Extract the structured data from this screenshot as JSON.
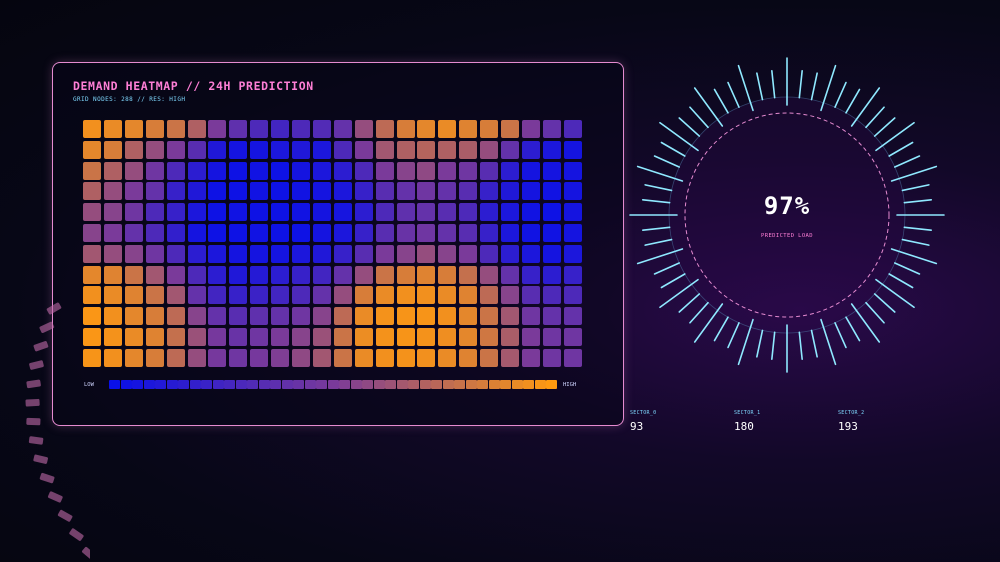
{
  "panel": {
    "title": "DEMAND HEATMAP // 24H PREDICTION",
    "subtitle": "GRID NODES: 288 // RES: HIGH"
  },
  "heatmap": {
    "rows": 12,
    "cols": 24,
    "values": [
      [
        0.95,
        0.92,
        0.9,
        0.85,
        0.8,
        0.7,
        0.5,
        0.38,
        0.3,
        0.25,
        0.3,
        0.32,
        0.4,
        0.6,
        0.75,
        0.85,
        0.9,
        0.92,
        0.88,
        0.85,
        0.8,
        0.5,
        0.4,
        0.3
      ],
      [
        0.9,
        0.85,
        0.7,
        0.6,
        0.5,
        0.35,
        0.1,
        0.05,
        0.05,
        0.08,
        0.1,
        0.08,
        0.3,
        0.5,
        0.65,
        0.7,
        0.72,
        0.7,
        0.68,
        0.6,
        0.4,
        0.15,
        0.08,
        0.05
      ],
      [
        0.8,
        0.7,
        0.6,
        0.45,
        0.3,
        0.15,
        0.05,
        0.02,
        0.03,
        0.02,
        0.05,
        0.08,
        0.15,
        0.3,
        0.5,
        0.55,
        0.58,
        0.5,
        0.45,
        0.35,
        0.15,
        0.05,
        0.05,
        0.05
      ],
      [
        0.7,
        0.6,
        0.5,
        0.4,
        0.2,
        0.1,
        0.02,
        0.02,
        0.03,
        0.02,
        0.03,
        0.05,
        0.08,
        0.2,
        0.35,
        0.4,
        0.45,
        0.4,
        0.35,
        0.2,
        0.1,
        0.05,
        0.03,
        0.05
      ],
      [
        0.6,
        0.55,
        0.45,
        0.3,
        0.2,
        0.08,
        0.02,
        0.03,
        0.02,
        0.02,
        0.03,
        0.05,
        0.06,
        0.15,
        0.3,
        0.38,
        0.4,
        0.35,
        0.3,
        0.15,
        0.08,
        0.03,
        0.02,
        0.05
      ],
      [
        0.55,
        0.5,
        0.4,
        0.3,
        0.18,
        0.05,
        0.02,
        0.02,
        0.03,
        0.02,
        0.02,
        0.05,
        0.08,
        0.2,
        0.35,
        0.42,
        0.45,
        0.4,
        0.35,
        0.2,
        0.08,
        0.03,
        0.03,
        0.05
      ],
      [
        0.65,
        0.6,
        0.55,
        0.45,
        0.3,
        0.15,
        0.08,
        0.05,
        0.05,
        0.05,
        0.08,
        0.1,
        0.2,
        0.35,
        0.5,
        0.55,
        0.6,
        0.55,
        0.5,
        0.3,
        0.15,
        0.08,
        0.05,
        0.08
      ],
      [
        0.9,
        0.88,
        0.8,
        0.65,
        0.5,
        0.3,
        0.15,
        0.1,
        0.12,
        0.15,
        0.2,
        0.25,
        0.4,
        0.6,
        0.8,
        0.85,
        0.88,
        0.85,
        0.78,
        0.6,
        0.4,
        0.2,
        0.15,
        0.2
      ],
      [
        0.95,
        0.92,
        0.88,
        0.8,
        0.65,
        0.4,
        0.25,
        0.2,
        0.22,
        0.25,
        0.3,
        0.4,
        0.6,
        0.85,
        0.92,
        0.95,
        0.95,
        0.92,
        0.88,
        0.75,
        0.55,
        0.35,
        0.3,
        0.3
      ],
      [
        0.98,
        0.95,
        0.9,
        0.85,
        0.75,
        0.55,
        0.4,
        0.35,
        0.38,
        0.4,
        0.45,
        0.55,
        0.75,
        0.92,
        0.96,
        0.97,
        0.97,
        0.95,
        0.9,
        0.8,
        0.65,
        0.45,
        0.4,
        0.4
      ],
      [
        0.98,
        0.96,
        0.92,
        0.88,
        0.78,
        0.62,
        0.48,
        0.42,
        0.45,
        0.5,
        0.55,
        0.62,
        0.8,
        0.93,
        0.96,
        0.97,
        0.96,
        0.94,
        0.9,
        0.82,
        0.68,
        0.5,
        0.45,
        0.45
      ],
      [
        0.97,
        0.95,
        0.9,
        0.85,
        0.75,
        0.6,
        0.48,
        0.45,
        0.48,
        0.52,
        0.58,
        0.65,
        0.8,
        0.92,
        0.95,
        0.96,
        0.95,
        0.92,
        0.88,
        0.8,
        0.66,
        0.5,
        0.45,
        0.45
      ]
    ],
    "color_low": "#0a10e8",
    "color_mid": "#7a3a9a",
    "color_high": "#ff9a10"
  },
  "legend": {
    "low_label": "LOW",
    "high_label": "HIGH",
    "steps": 39
  },
  "gauge": {
    "value": "97%",
    "label": "PREDICTED LOAD",
    "fraction": 0.97,
    "tick_color": "#8fe9ff",
    "ring_color": "#e58bd0"
  },
  "sectors": [
    {
      "label": "SECTOR_0",
      "value": "93"
    },
    {
      "label": "SECTOR_1",
      "value": "180"
    },
    {
      "label": "SECTOR_2",
      "value": "193"
    }
  ],
  "colors": {
    "accent_pink": "#ff7fd6",
    "accent_cyan": "#7fd9ff",
    "panel_border": "#e58bd0"
  }
}
